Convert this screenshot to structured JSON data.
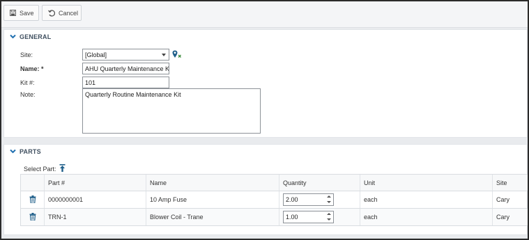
{
  "toolbar": {
    "save_label": "Save",
    "save_icon": "floppy-disk-icon",
    "cancel_label": "Cancel",
    "cancel_icon": "undo-icon"
  },
  "general": {
    "title": "GENERAL",
    "site": {
      "label": "Site:",
      "value": "[Global]"
    },
    "name": {
      "label": "Name: *",
      "value": "AHU Quarterly Maintenance Kit"
    },
    "kit": {
      "label": "Kit #:",
      "value": "101"
    },
    "note": {
      "label": "Note:",
      "value": "Quarterly Routine Maintenance Kit"
    }
  },
  "parts": {
    "title": "PARTS",
    "select_part_label": "Select Part:",
    "columns": [
      "Part #",
      "Name",
      "Quantity",
      "Unit",
      "Site"
    ],
    "rows": [
      {
        "part": "0000000001",
        "name": "10 Amp Fuse",
        "quantity": "2.00",
        "unit": "each",
        "site": "Cary"
      },
      {
        "part": "TRN-1",
        "name": "Blower Coil - Trane",
        "quantity": "1.00",
        "unit": "each",
        "site": "Cary"
      }
    ]
  },
  "colors": {
    "accent": "#1f6fb0",
    "section_text": "#3f4f5f",
    "background": "#e9ebee"
  }
}
